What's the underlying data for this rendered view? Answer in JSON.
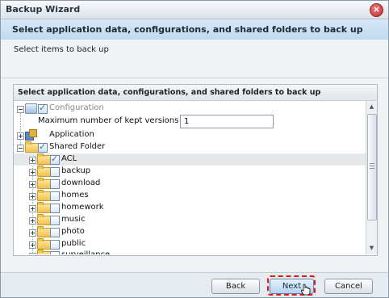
{
  "window": {
    "title": "Backup Wizard",
    "close_glyph": "×"
  },
  "header": {
    "title": "Select application data, configurations, and shared folders to back up"
  },
  "subtitle": "Select items to back up",
  "panel": {
    "title": "Select application data, configurations, and shared folders to back up"
  },
  "tree": {
    "configuration": {
      "label": "Configuration",
      "checked": true,
      "disabled": true
    },
    "versions": {
      "label": "Maximum number of kept versions",
      "value": "1"
    },
    "application": {
      "label": "Application",
      "checked": false
    },
    "shared_folder": {
      "label": "Shared Folder",
      "checked": true
    },
    "folders": [
      {
        "label": "ACL",
        "checked": true,
        "selected": true
      },
      {
        "label": "backup",
        "checked": false
      },
      {
        "label": "download",
        "checked": false
      },
      {
        "label": "homes",
        "checked": false
      },
      {
        "label": "homework",
        "checked": false
      },
      {
        "label": "music",
        "checked": false
      },
      {
        "label": "photo",
        "checked": false
      },
      {
        "label": "public",
        "checked": false
      },
      {
        "label": "surveillance",
        "checked": false
      }
    ]
  },
  "buttons": {
    "back": "Back",
    "next": "Next",
    "cancel": "Cancel"
  },
  "colors": {
    "header_bg": "#c0d9f0",
    "highlight": "#e01919"
  }
}
